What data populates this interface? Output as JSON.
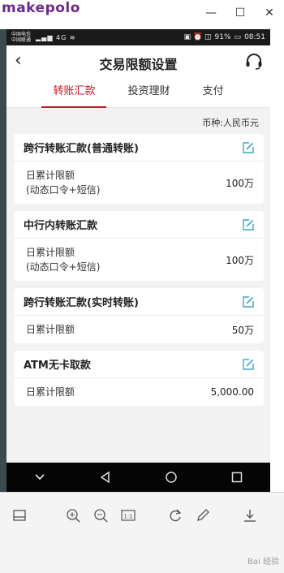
{
  "viewer": {
    "watermark": "makepolo",
    "controls": [
      "minimize",
      "maximize",
      "close"
    ],
    "brand": "Bai 经验"
  },
  "statusbar": {
    "carrier_line1": "中国电信",
    "carrier_line2": "中国联通",
    "signal": "4G",
    "battery": "91%",
    "time": "08:51"
  },
  "header": {
    "title": "交易限额设置",
    "back_icon": "chevron-left",
    "support_icon": "headset"
  },
  "tabs": [
    {
      "label": "转账汇款",
      "active": true
    },
    {
      "label": "投资理财",
      "active": false
    },
    {
      "label": "支付",
      "active": false
    }
  ],
  "currency_label": "币种:人民币元",
  "cards": [
    {
      "title": "跨行转账汇款(普通转账)",
      "label_line1": "日累计限额",
      "label_line2": "(动态口令+短信)",
      "value": "100万"
    },
    {
      "title": "中行内转账汇款",
      "label_line1": "日累计限额",
      "label_line2": "(动态口令+短信)",
      "value": "100万"
    },
    {
      "title": "跨行转账汇款(实时转账)",
      "label_line1": "日累计限额",
      "label_line2": "",
      "value": "50万"
    },
    {
      "title": "ATM无卡取款",
      "label_line1": "日累计限额",
      "label_line2": "",
      "value": "5,000.00"
    }
  ],
  "colors": {
    "accent": "#c9151e",
    "edit_icon": "#3aa7c9"
  }
}
